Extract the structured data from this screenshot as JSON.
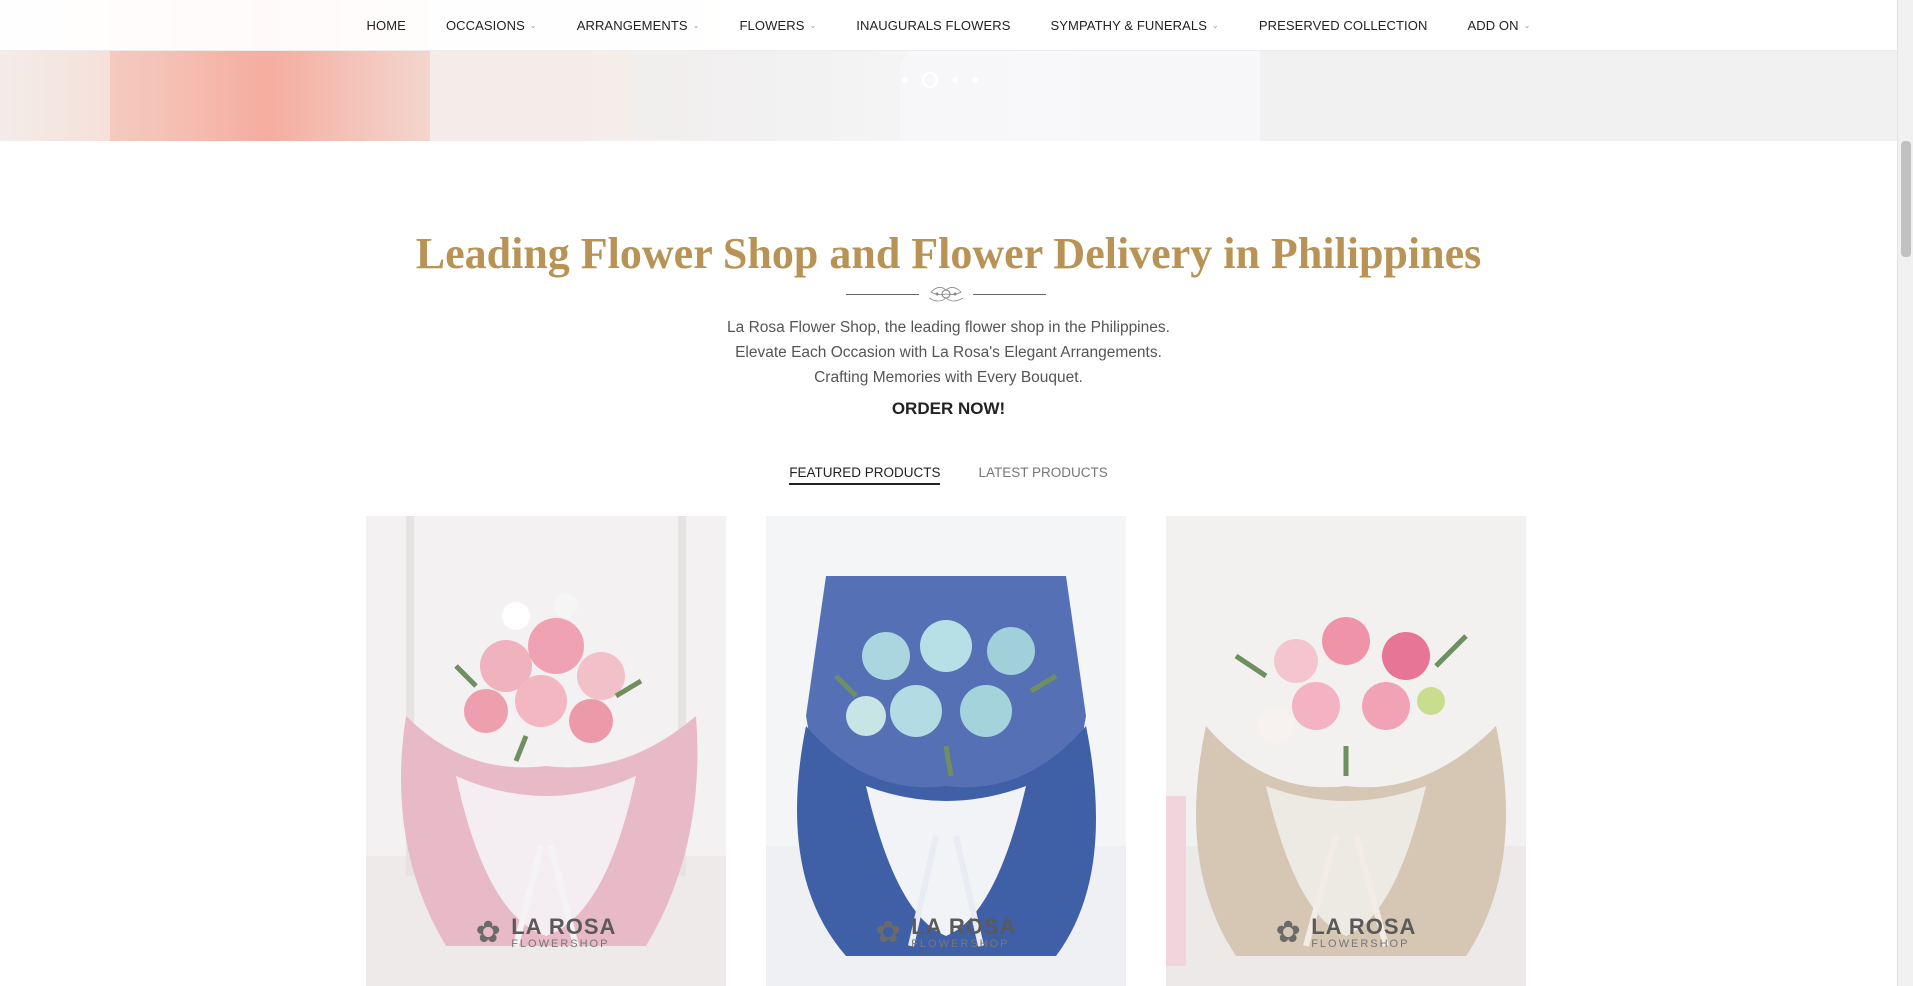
{
  "nav": {
    "items": [
      {
        "label": "HOME",
        "has_dropdown": false
      },
      {
        "label": "OCCASIONS",
        "has_dropdown": true
      },
      {
        "label": "ARRANGEMENTS",
        "has_dropdown": true
      },
      {
        "label": "FLOWERS",
        "has_dropdown": true
      },
      {
        "label": "INAUGURALS FLOWERS",
        "has_dropdown": false
      },
      {
        "label": "SYMPATHY & FUNERALS",
        "has_dropdown": true
      },
      {
        "label": "PRESERVED COLLECTION",
        "has_dropdown": false
      },
      {
        "label": "ADD ON",
        "has_dropdown": true
      }
    ]
  },
  "slider": {
    "dot_count": 4,
    "active_index": 1
  },
  "main": {
    "headline": "Leading Flower Shop and Flower Delivery in Philippines",
    "description": [
      "La Rosa Flower Shop, the leading flower shop in the Philippines.",
      "Elevate Each Occasion with La Rosa's Elegant Arrangements.",
      "Crafting Memories with Every Bouquet."
    ],
    "order_now": "ORDER NOW!"
  },
  "tabs": [
    {
      "label": "FEATURED PRODUCTS",
      "active": true
    },
    {
      "label": "LATEST PRODUCTS",
      "active": false
    }
  ],
  "products": [
    {
      "logo_brand": "LA ROSA",
      "logo_sub": "FLOWERSHOP",
      "wrap_color": "#e8b9c6",
      "flower_color": "#f0a7b4"
    },
    {
      "logo_brand": "LA ROSA",
      "logo_sub": "FLOWERSHOP",
      "wrap_color": "#3f5fa6",
      "flower_color": "#a9d6df"
    },
    {
      "logo_brand": "LA ROSA",
      "logo_sub": "FLOWERSHOP",
      "wrap_color": "#d6c6b4",
      "flower_color": "#ef93a8"
    }
  ],
  "colors": {
    "accent_gold": "#b89355",
    "text_dark": "#222222"
  }
}
